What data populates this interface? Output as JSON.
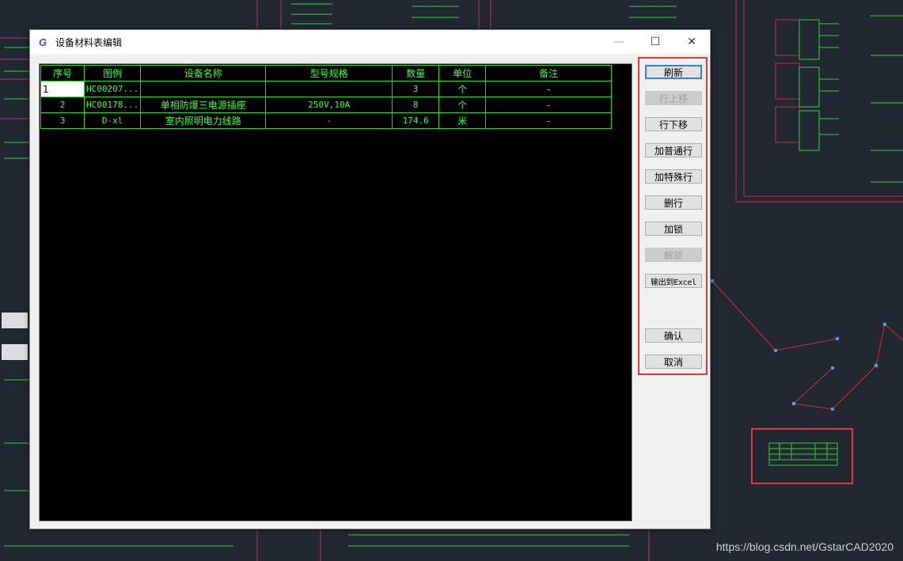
{
  "window": {
    "title": "设备材料表编辑",
    "icon_letter": "G",
    "minimize": "—",
    "maximize": "☐",
    "close": "✕"
  },
  "table": {
    "headers": [
      "序号",
      "图例",
      "设备名称",
      "型号规格",
      "数量",
      "单位",
      "备注"
    ],
    "rows": [
      [
        "1",
        "HC00207...",
        "",
        "",
        "3",
        "个",
        "-"
      ],
      [
        "2",
        "HC00178...",
        "单相防爆三电源插座",
        "250V,10A",
        "8",
        "个",
        "-"
      ],
      [
        "3",
        "D-xl",
        "室内照明电力线路",
        "-",
        "174.6",
        "米",
        "-"
      ]
    ]
  },
  "buttons": {
    "refresh": "刷新",
    "move_up": "行上移",
    "move_down": "行下移",
    "add_normal": "加普通行",
    "add_special": "加特殊行",
    "delete_row": "删行",
    "lock": "加锁",
    "unlock": "解锁",
    "export_excel": "输出到Excel",
    "confirm": "确认",
    "cancel": "取消"
  },
  "watermark": "https://blog.csdn.net/GstarCAD2020",
  "colors": {
    "grid_text": "#39ff39",
    "grid_line": "#2bd62b",
    "highlight_box": "#e8383d",
    "cad_background": "#222831"
  }
}
